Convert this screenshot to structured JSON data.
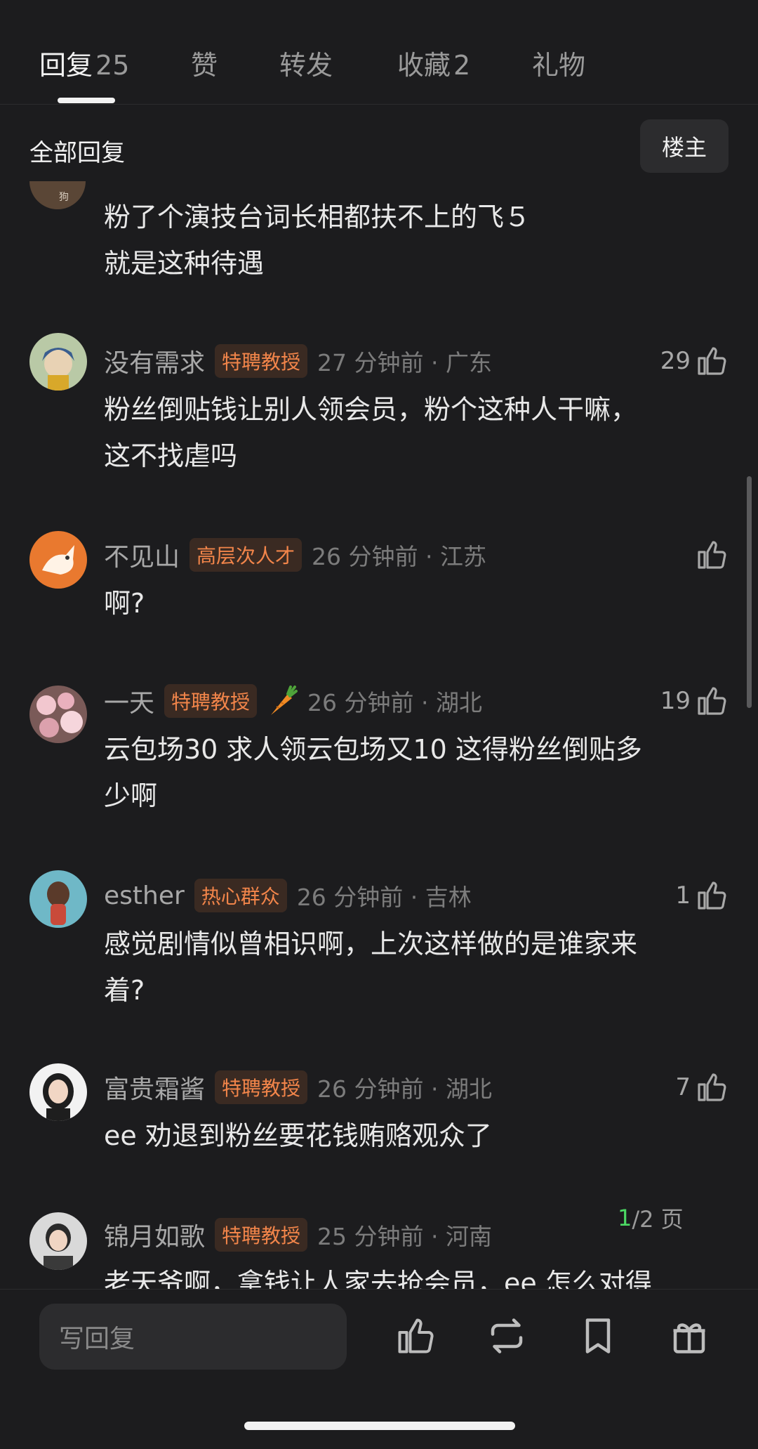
{
  "tabs": [
    {
      "label": "回复",
      "count": "25"
    },
    {
      "label": "赞",
      "count": ""
    },
    {
      "label": "转发",
      "count": ""
    },
    {
      "label": "收藏",
      "count": "2"
    },
    {
      "label": "礼物",
      "count": ""
    }
  ],
  "section_title": "全部回复",
  "owner_button": "楼主",
  "partial_avatar_text": "狗",
  "prev_comment_lines": [
    "粉了个演技台词长相都扶不上的飞５",
    "就是这种待遇"
  ],
  "comments": [
    {
      "name": "没有需求",
      "badge": "特聘教授",
      "meta": "27 分钟前 · 广东",
      "likes": "29",
      "lines": [
        "粉丝倒贴钱让别人领会员，粉个这种人干嘛，",
        "这不找虐吗"
      ]
    },
    {
      "name": "不见山",
      "badge": "高层次人才",
      "meta": "26 分钟前 · 江苏",
      "likes": "",
      "lines": [
        "啊?"
      ]
    },
    {
      "name": "一天",
      "badge": "特聘教授",
      "meta": "26 分钟前 · 湖北",
      "likes": "19",
      "lines": [
        "云包场30 求人领云包场又10 这得粉丝倒贴多",
        "少啊"
      ]
    },
    {
      "name": "esther",
      "badge": "热心群众",
      "meta": "26 分钟前 · 吉林",
      "likes": "1",
      "lines": [
        "感觉剧情似曾相识啊，上次这样做的是谁家来",
        "着?"
      ]
    },
    {
      "name": "富贵霜酱",
      "badge": "特聘教授",
      "meta": "26 分钟前 · 湖北",
      "likes": "7",
      "lines": [
        "ee 劝退到粉丝要花钱贿赂观众了"
      ]
    },
    {
      "name": "锦月如歌",
      "badge": "特聘教授",
      "meta": "25 分钟前 · 河南",
      "likes": "",
      "lines": [
        "老天爷啊，拿钱让人家去抢会员，ee 怎么对得"
      ]
    }
  ],
  "pager": {
    "current": "1",
    "total": "/2 页"
  },
  "reply_placeholder": "写回复",
  "icons": [
    "thumbs-up-icon",
    "repost-icon",
    "bookmark-icon",
    "gift-icon",
    "carrot-icon"
  ],
  "colors": {
    "background": "#1c1c1e",
    "badge_text": "#f2854a",
    "badge_bg": "#3a2a22",
    "pager_current": "#4cd964"
  }
}
